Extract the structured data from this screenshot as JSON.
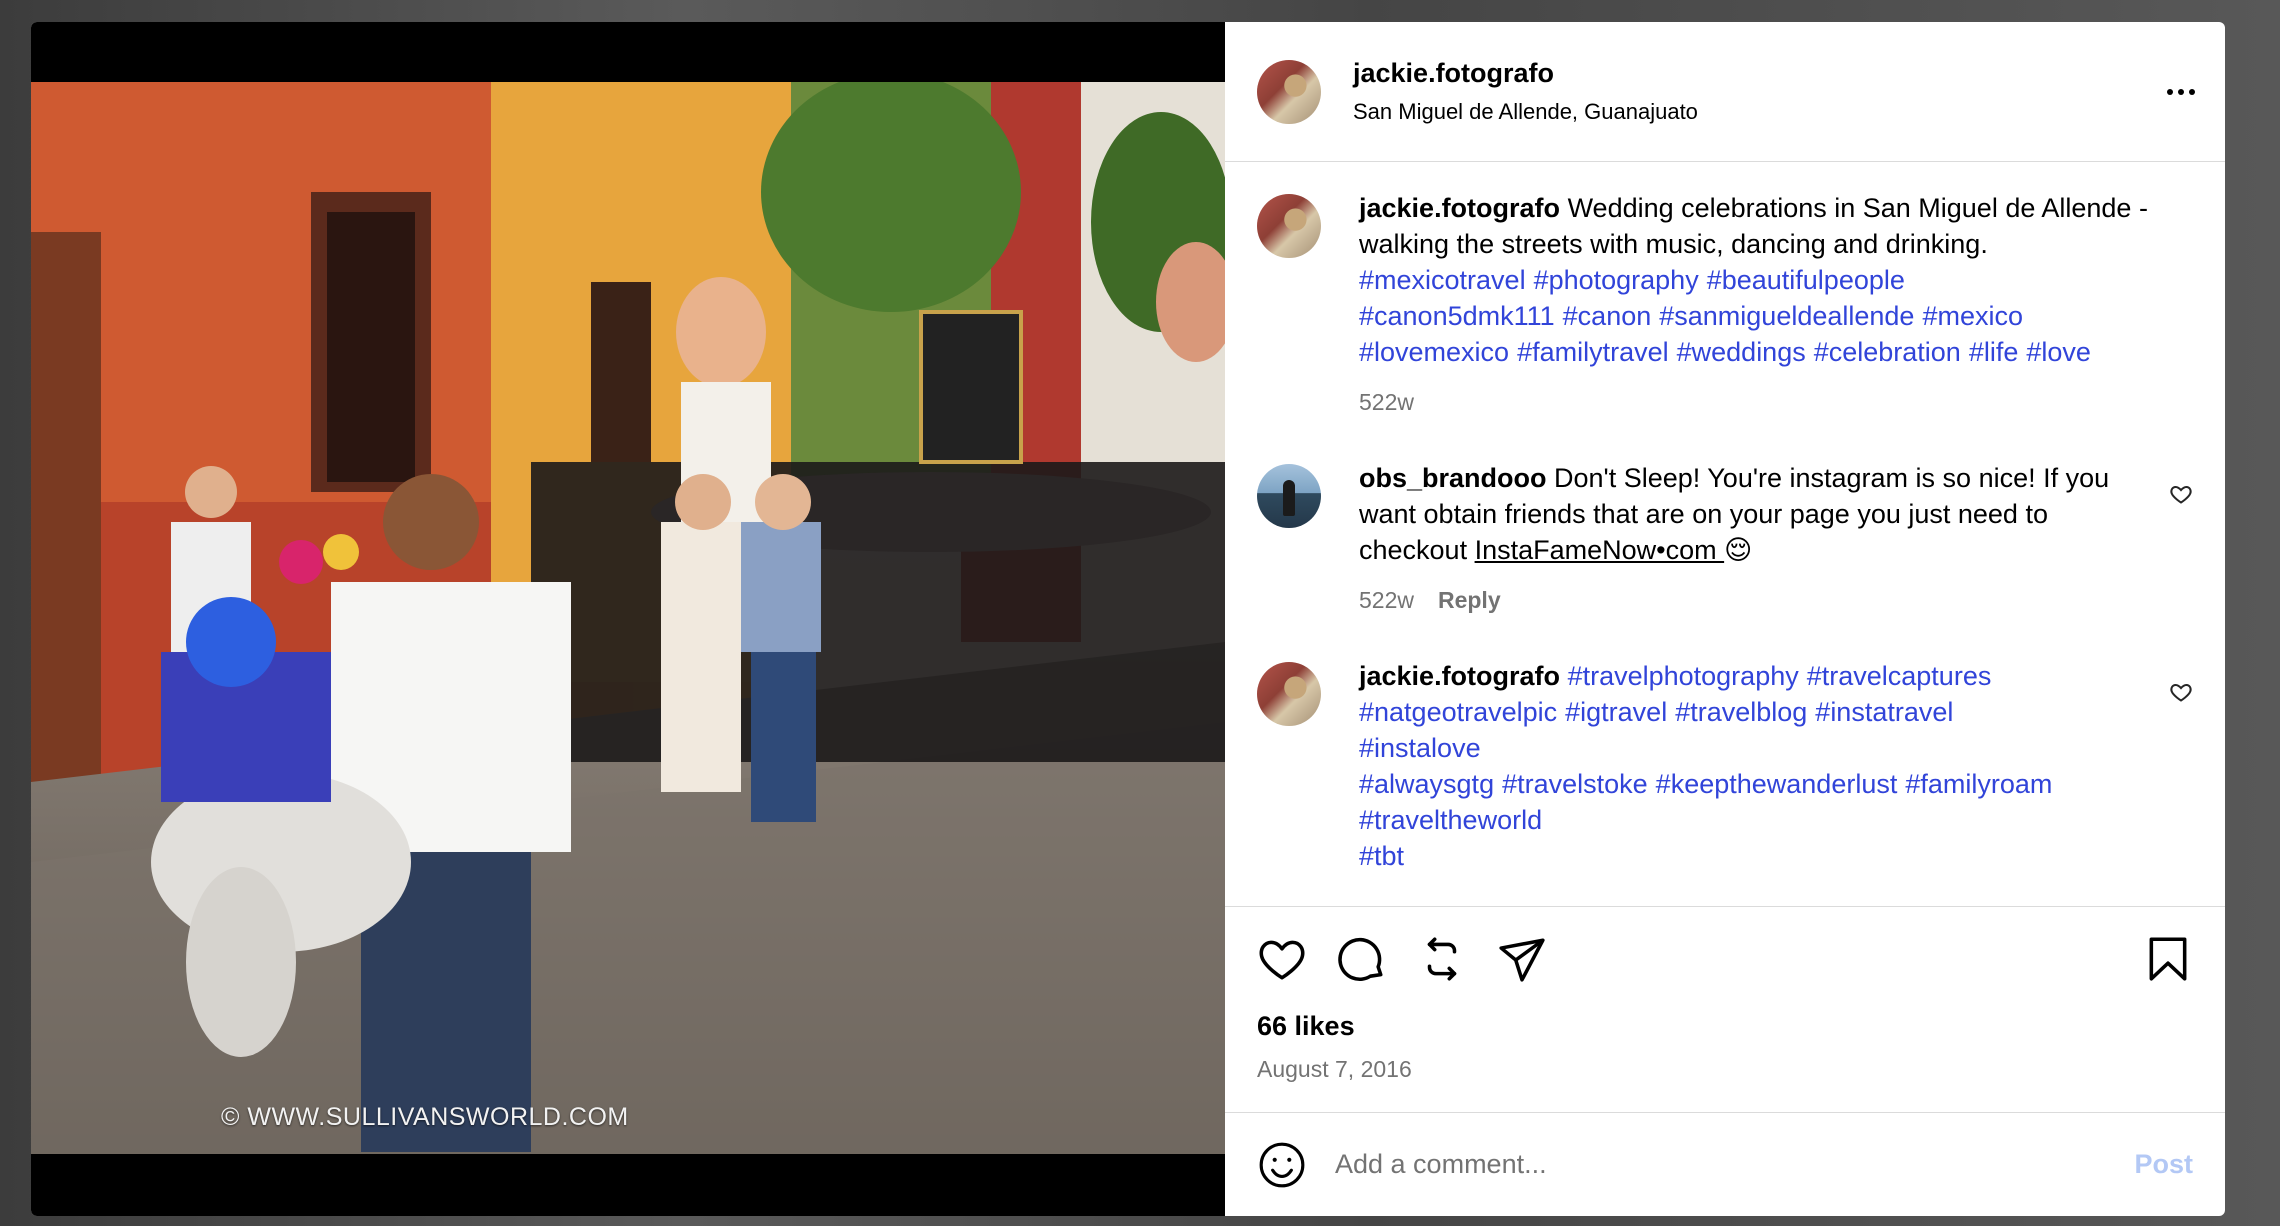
{
  "media": {
    "watermark": "© WWW.SULLIVANSWORLD.COM"
  },
  "post": {
    "username": "jackie.fotografo",
    "location": "San Miguel de Allende, Guanajuato"
  },
  "caption": {
    "username": "jackie.fotografo",
    "text": "Wedding celebrations in San Miguel de Allende - walking the streets with music, dancing and drinking.",
    "hashtags": [
      "#mexicotravel",
      "#photography",
      "#beautifulpeople",
      "#canon5dmk111",
      "#canon",
      "#sanmigueldeallende",
      "#mexico",
      "#lovemexico",
      "#familytravel",
      "#weddings",
      "#celebration",
      "#life",
      "#love"
    ],
    "time": "522w"
  },
  "comments": [
    {
      "username": "obs_brandooo",
      "text": "Don't Sleep! You're instagram is so nice! If you want obtain friends that are on your page you just need to checkout ",
      "link": "InstaFameNow•com ",
      "emoji": "😌",
      "time": "522w",
      "reply_label": "Reply"
    },
    {
      "username": "jackie.fotografo",
      "hashtags_line1": [
        "#travelphotography",
        "#travelcaptures",
        "#natgeotravelpic",
        "#igtravel",
        "#travelblog",
        "#instatravel",
        "#instalove"
      ],
      "hashtags_line2": [
        "#alwaysgtg",
        "#travelstoke",
        "#keepthewanderlust",
        "#familyroam",
        "#traveltheworld"
      ],
      "hashtags_cut": "#tbt"
    }
  ],
  "engagement": {
    "likes": "66 likes",
    "date": "August 7, 2016"
  },
  "add_comment": {
    "placeholder": "Add a comment...",
    "post_label": "Post"
  }
}
